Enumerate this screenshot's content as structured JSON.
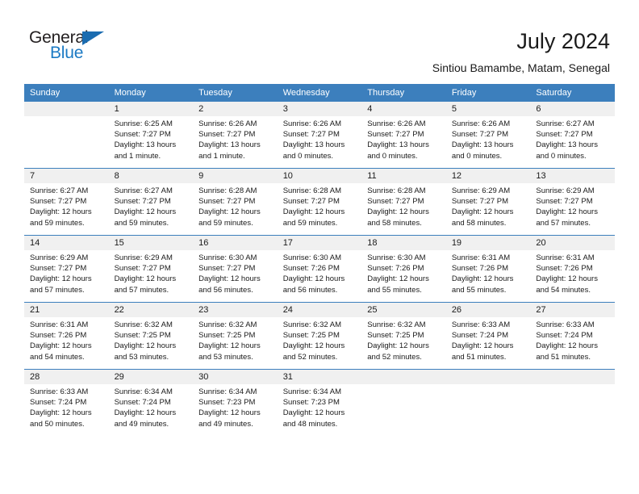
{
  "brand": {
    "name_top": "General",
    "name_bottom": "Blue",
    "accent_color": "#1b7ac4",
    "triangle_color": "#1b6cb0"
  },
  "header": {
    "title": "July 2024",
    "subtitle": "Sintiou Bamambe, Matam, Senegal"
  },
  "calendar": {
    "header_bg": "#3c7fbd",
    "date_band_bg": "#f0f0f0",
    "weekdays": [
      "Sunday",
      "Monday",
      "Tuesday",
      "Wednesday",
      "Thursday",
      "Friday",
      "Saturday"
    ],
    "weeks": [
      [
        {
          "day": "",
          "sunrise": "",
          "sunset": "",
          "daylight": ""
        },
        {
          "day": "1",
          "sunrise": "Sunrise: 6:25 AM",
          "sunset": "Sunset: 7:27 PM",
          "daylight": "Daylight: 13 hours and 1 minute."
        },
        {
          "day": "2",
          "sunrise": "Sunrise: 6:26 AM",
          "sunset": "Sunset: 7:27 PM",
          "daylight": "Daylight: 13 hours and 1 minute."
        },
        {
          "day": "3",
          "sunrise": "Sunrise: 6:26 AM",
          "sunset": "Sunset: 7:27 PM",
          "daylight": "Daylight: 13 hours and 0 minutes."
        },
        {
          "day": "4",
          "sunrise": "Sunrise: 6:26 AM",
          "sunset": "Sunset: 7:27 PM",
          "daylight": "Daylight: 13 hours and 0 minutes."
        },
        {
          "day": "5",
          "sunrise": "Sunrise: 6:26 AM",
          "sunset": "Sunset: 7:27 PM",
          "daylight": "Daylight: 13 hours and 0 minutes."
        },
        {
          "day": "6",
          "sunrise": "Sunrise: 6:27 AM",
          "sunset": "Sunset: 7:27 PM",
          "daylight": "Daylight: 13 hours and 0 minutes."
        }
      ],
      [
        {
          "day": "7",
          "sunrise": "Sunrise: 6:27 AM",
          "sunset": "Sunset: 7:27 PM",
          "daylight": "Daylight: 12 hours and 59 minutes."
        },
        {
          "day": "8",
          "sunrise": "Sunrise: 6:27 AM",
          "sunset": "Sunset: 7:27 PM",
          "daylight": "Daylight: 12 hours and 59 minutes."
        },
        {
          "day": "9",
          "sunrise": "Sunrise: 6:28 AM",
          "sunset": "Sunset: 7:27 PM",
          "daylight": "Daylight: 12 hours and 59 minutes."
        },
        {
          "day": "10",
          "sunrise": "Sunrise: 6:28 AM",
          "sunset": "Sunset: 7:27 PM",
          "daylight": "Daylight: 12 hours and 59 minutes."
        },
        {
          "day": "11",
          "sunrise": "Sunrise: 6:28 AM",
          "sunset": "Sunset: 7:27 PM",
          "daylight": "Daylight: 12 hours and 58 minutes."
        },
        {
          "day": "12",
          "sunrise": "Sunrise: 6:29 AM",
          "sunset": "Sunset: 7:27 PM",
          "daylight": "Daylight: 12 hours and 58 minutes."
        },
        {
          "day": "13",
          "sunrise": "Sunrise: 6:29 AM",
          "sunset": "Sunset: 7:27 PM",
          "daylight": "Daylight: 12 hours and 57 minutes."
        }
      ],
      [
        {
          "day": "14",
          "sunrise": "Sunrise: 6:29 AM",
          "sunset": "Sunset: 7:27 PM",
          "daylight": "Daylight: 12 hours and 57 minutes."
        },
        {
          "day": "15",
          "sunrise": "Sunrise: 6:29 AM",
          "sunset": "Sunset: 7:27 PM",
          "daylight": "Daylight: 12 hours and 57 minutes."
        },
        {
          "day": "16",
          "sunrise": "Sunrise: 6:30 AM",
          "sunset": "Sunset: 7:27 PM",
          "daylight": "Daylight: 12 hours and 56 minutes."
        },
        {
          "day": "17",
          "sunrise": "Sunrise: 6:30 AM",
          "sunset": "Sunset: 7:26 PM",
          "daylight": "Daylight: 12 hours and 56 minutes."
        },
        {
          "day": "18",
          "sunrise": "Sunrise: 6:30 AM",
          "sunset": "Sunset: 7:26 PM",
          "daylight": "Daylight: 12 hours and 55 minutes."
        },
        {
          "day": "19",
          "sunrise": "Sunrise: 6:31 AM",
          "sunset": "Sunset: 7:26 PM",
          "daylight": "Daylight: 12 hours and 55 minutes."
        },
        {
          "day": "20",
          "sunrise": "Sunrise: 6:31 AM",
          "sunset": "Sunset: 7:26 PM",
          "daylight": "Daylight: 12 hours and 54 minutes."
        }
      ],
      [
        {
          "day": "21",
          "sunrise": "Sunrise: 6:31 AM",
          "sunset": "Sunset: 7:26 PM",
          "daylight": "Daylight: 12 hours and 54 minutes."
        },
        {
          "day": "22",
          "sunrise": "Sunrise: 6:32 AM",
          "sunset": "Sunset: 7:25 PM",
          "daylight": "Daylight: 12 hours and 53 minutes."
        },
        {
          "day": "23",
          "sunrise": "Sunrise: 6:32 AM",
          "sunset": "Sunset: 7:25 PM",
          "daylight": "Daylight: 12 hours and 53 minutes."
        },
        {
          "day": "24",
          "sunrise": "Sunrise: 6:32 AM",
          "sunset": "Sunset: 7:25 PM",
          "daylight": "Daylight: 12 hours and 52 minutes."
        },
        {
          "day": "25",
          "sunrise": "Sunrise: 6:32 AM",
          "sunset": "Sunset: 7:25 PM",
          "daylight": "Daylight: 12 hours and 52 minutes."
        },
        {
          "day": "26",
          "sunrise": "Sunrise: 6:33 AM",
          "sunset": "Sunset: 7:24 PM",
          "daylight": "Daylight: 12 hours and 51 minutes."
        },
        {
          "day": "27",
          "sunrise": "Sunrise: 6:33 AM",
          "sunset": "Sunset: 7:24 PM",
          "daylight": "Daylight: 12 hours and 51 minutes."
        }
      ],
      [
        {
          "day": "28",
          "sunrise": "Sunrise: 6:33 AM",
          "sunset": "Sunset: 7:24 PM",
          "daylight": "Daylight: 12 hours and 50 minutes."
        },
        {
          "day": "29",
          "sunrise": "Sunrise: 6:34 AM",
          "sunset": "Sunset: 7:24 PM",
          "daylight": "Daylight: 12 hours and 49 minutes."
        },
        {
          "day": "30",
          "sunrise": "Sunrise: 6:34 AM",
          "sunset": "Sunset: 7:23 PM",
          "daylight": "Daylight: 12 hours and 49 minutes."
        },
        {
          "day": "31",
          "sunrise": "Sunrise: 6:34 AM",
          "sunset": "Sunset: 7:23 PM",
          "daylight": "Daylight: 12 hours and 48 minutes."
        },
        {
          "day": "",
          "sunrise": "",
          "sunset": "",
          "daylight": ""
        },
        {
          "day": "",
          "sunrise": "",
          "sunset": "",
          "daylight": ""
        },
        {
          "day": "",
          "sunrise": "",
          "sunset": "",
          "daylight": ""
        }
      ]
    ]
  }
}
